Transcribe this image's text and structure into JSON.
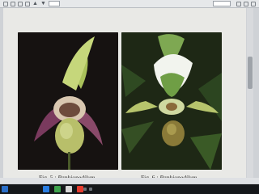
{
  "viewer": {
    "page_number": "",
    "zoom": "",
    "status_text": ""
  },
  "document": {
    "top_text": "",
    "figures": [
      {
        "label": "Fig. 5 :",
        "name": "Paphiopedilum"
      },
      {
        "label": "Fig. 6 :",
        "name": "Paphiopedilum"
      }
    ]
  },
  "taskbar": {
    "start_label": "",
    "time": "",
    "date": ""
  },
  "colors": {
    "taskbar": "#15171a",
    "document_bg": "#e9e9e6",
    "accent_blue": "#2b6fc9"
  }
}
